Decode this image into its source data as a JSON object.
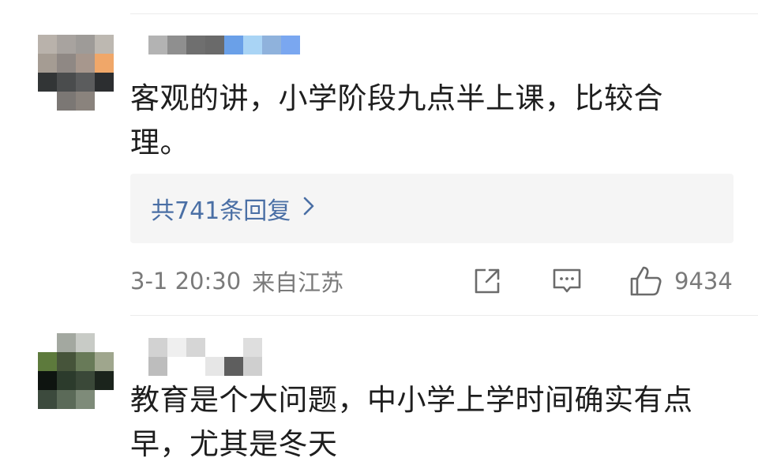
{
  "comments": [
    {
      "text": "客观的讲，小学阶段九点半上课，比较合理。",
      "replies_label": "共741条回复",
      "time": "3-1 20:30",
      "location": "来自江苏",
      "likes": "9434"
    },
    {
      "text": "教育是个大问题，中小学上学时间确实有点早，尤其是冬天"
    }
  ],
  "icons": {
    "share": "share-icon",
    "comment": "comment-icon",
    "like": "thumbs-up-icon",
    "chevron": "chevron-right-icon"
  },
  "colors": {
    "reply_link": "#4a6fa5",
    "meta_text": "#7a7a7a",
    "reply_box_bg": "#f5f5f5"
  }
}
